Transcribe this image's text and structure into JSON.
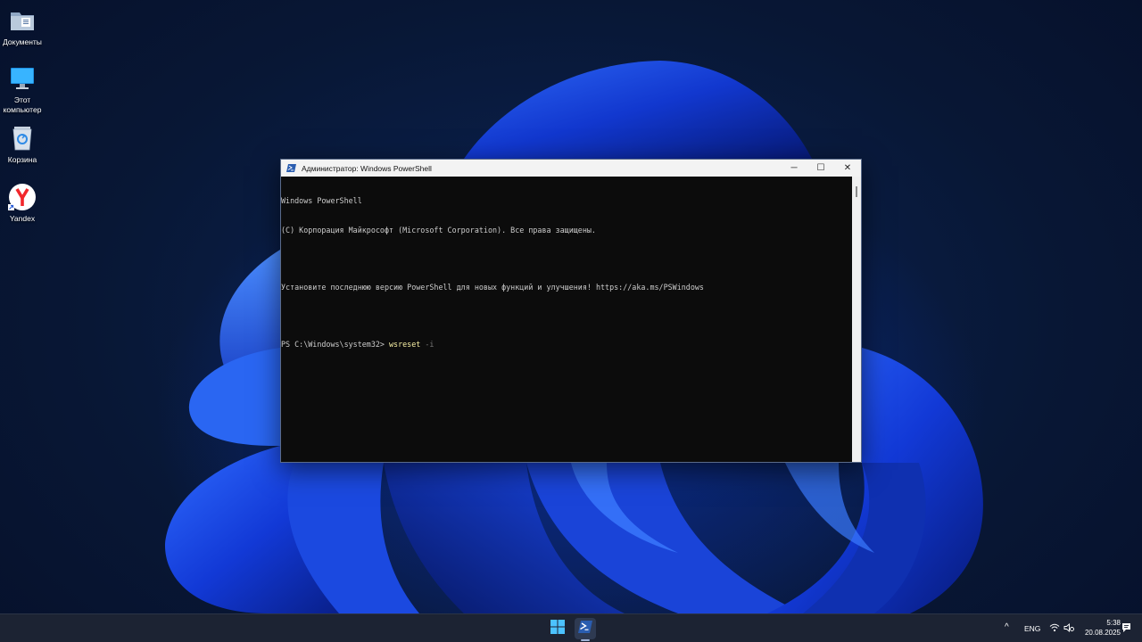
{
  "desktop": {
    "icons": [
      {
        "label": "Документы",
        "icon": "documents-folder-icon"
      },
      {
        "label": "Этот\nкомпьютер",
        "icon": "this-pc-icon"
      },
      {
        "label": "Корзина",
        "icon": "recycle-bin-icon"
      },
      {
        "label": "Yandex",
        "icon": "yandex-browser-icon"
      }
    ]
  },
  "window": {
    "title": "Администратор: Windows PowerShell",
    "icon": "powershell-icon",
    "controls": {
      "minimize": "─",
      "maximize": "☐",
      "close": "✕"
    },
    "console": {
      "lines": [
        "Windows PowerShell",
        "(C) Корпорация Майкрософт (Microsoft Corporation). Все права защищены.",
        "",
        "Установите последнюю версию PowerShell для новых функций и улучшения! https://aka.ms/PSWindows",
        ""
      ],
      "prompt": "PS C:\\Windows\\system32> ",
      "command": "wsreset",
      "argument": " -i"
    }
  },
  "taskbar": {
    "start_icon": "windows-start-icon",
    "pinned": [
      {
        "name": "powershell-taskbar-icon",
        "active": true
      }
    ],
    "tray": {
      "chevron": "^",
      "language": "ENG",
      "time": "5:38",
      "date": "20.08.2025"
    }
  },
  "colors": {
    "console_bg": "#0c0c0c",
    "console_text": "#cccccc",
    "command_color": "#f9f1a5",
    "argument_color": "#767676",
    "taskbar_bg": "#1c2333",
    "accent": "#0078d4"
  }
}
